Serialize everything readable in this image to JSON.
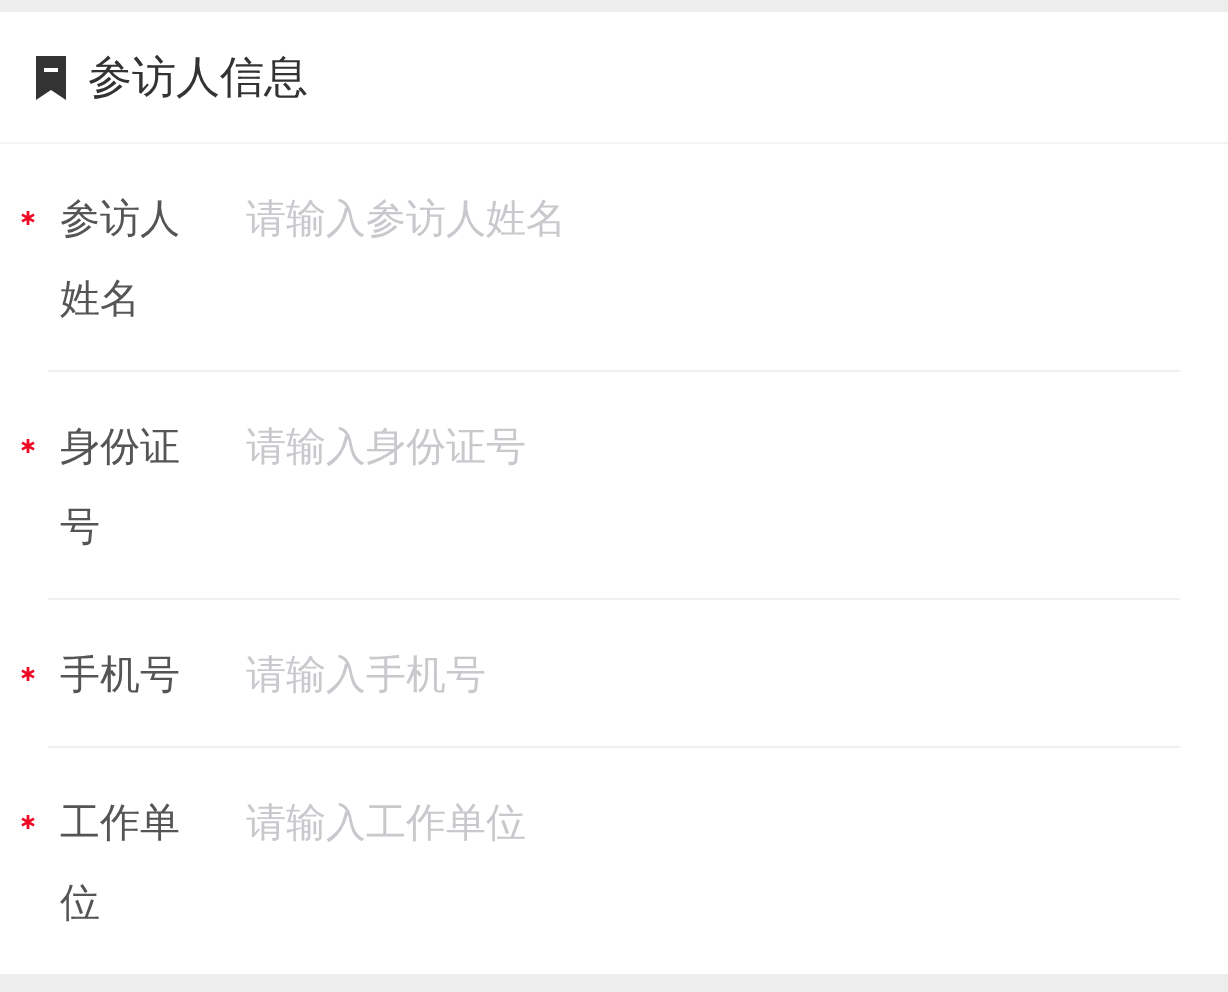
{
  "section": {
    "title": "参访人信息"
  },
  "fields": [
    {
      "label": "参访人姓名",
      "required": true,
      "placeholder": "请输入参访人姓名"
    },
    {
      "label": "身份证号",
      "required": true,
      "placeholder": "请输入身份证号"
    },
    {
      "label": "手机号",
      "required": true,
      "placeholder": "请输入手机号"
    },
    {
      "label": "工作单位",
      "required": true,
      "placeholder": "请输入工作单位"
    }
  ]
}
